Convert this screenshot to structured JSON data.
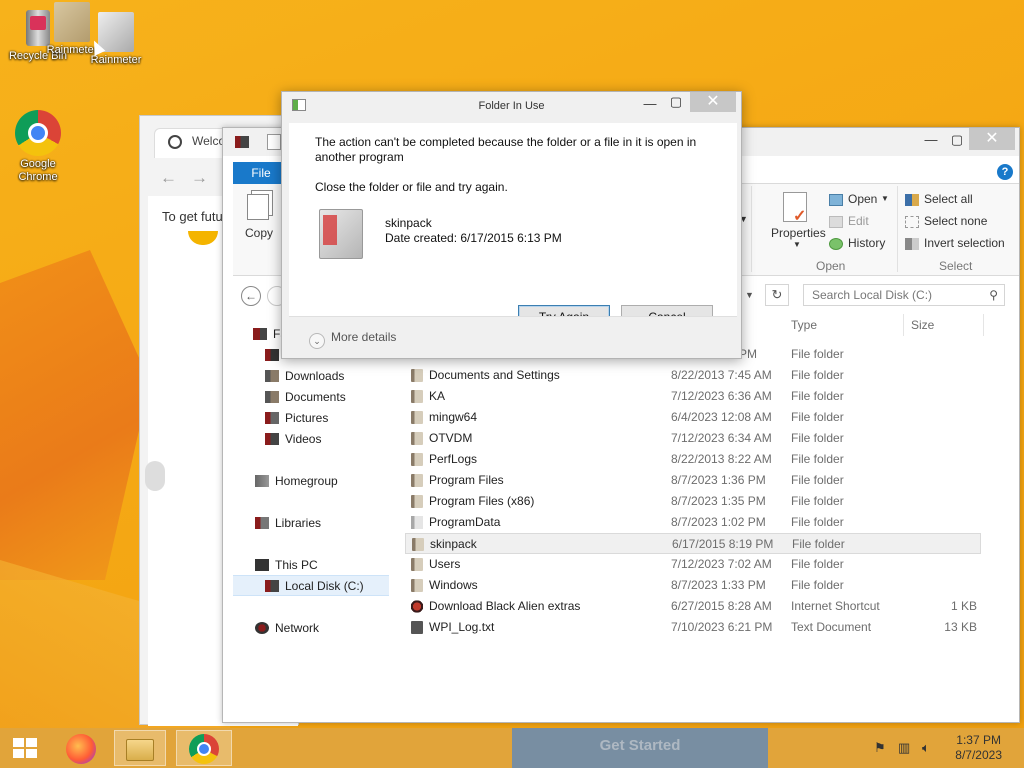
{
  "desktop": {
    "icons": [
      {
        "label": "Recycle Bin"
      },
      {
        "label": "Rainmeter"
      },
      {
        "label": "Rainmeter"
      },
      {
        "label": "Google Chrome"
      }
    ]
  },
  "browser": {
    "tab_label": "Welco",
    "page_text": "To get futu"
  },
  "explorer": {
    "ribbon": {
      "file_tab": "File",
      "copy": "Copy",
      "properties": "Properties",
      "open": "Open",
      "edit": "Edit",
      "history": "History",
      "select_all": "Select all",
      "select_none": "Select none",
      "invert_selection": "Invert selection",
      "group_open": "Open",
      "group_select": "Select"
    },
    "search_placeholder": "Search Local Disk (C:)",
    "columns": {
      "type": "Type",
      "size": "Size"
    },
    "nav": {
      "favorites": "Fa",
      "downloads": "Downloads",
      "documents": "Documents",
      "pictures": "Pictures",
      "videos": "Videos",
      "homegroup": "Homegroup",
      "libraries": "Libraries",
      "this_pc": "This PC",
      "local_disk": "Local Disk (C:)",
      "network": "Network"
    },
    "partial_row": {
      "date": "PM",
      "type": "File folder"
    },
    "rows": [
      {
        "name": "Documents and Settings",
        "date": "8/22/2013 7:45 AM",
        "type": "File folder",
        "size": ""
      },
      {
        "name": "KA",
        "date": "7/12/2023 6:36 AM",
        "type": "File folder",
        "size": ""
      },
      {
        "name": "mingw64",
        "date": "6/4/2023 12:08 AM",
        "type": "File folder",
        "size": ""
      },
      {
        "name": "OTVDM",
        "date": "7/12/2023 6:34 AM",
        "type": "File folder",
        "size": ""
      },
      {
        "name": "PerfLogs",
        "date": "8/22/2013 8:22 AM",
        "type": "File folder",
        "size": ""
      },
      {
        "name": "Program Files",
        "date": "8/7/2023 1:36 PM",
        "type": "File folder",
        "size": ""
      },
      {
        "name": "Program Files (x86)",
        "date": "8/7/2023 1:35 PM",
        "type": "File folder",
        "size": ""
      },
      {
        "name": "ProgramData",
        "date": "8/7/2023 1:02 PM",
        "type": "File folder",
        "size": ""
      },
      {
        "name": "skinpack",
        "date": "6/17/2015 8:19 PM",
        "type": "File folder",
        "size": ""
      },
      {
        "name": "Users",
        "date": "7/12/2023 7:02 AM",
        "type": "File folder",
        "size": ""
      },
      {
        "name": "Windows",
        "date": "8/7/2023 1:33 PM",
        "type": "File folder",
        "size": ""
      },
      {
        "name": "Download Black Alien extras",
        "date": "6/27/2015 8:28 AM",
        "type": "Internet Shortcut",
        "size": "1 KB"
      },
      {
        "name": "WPI_Log.txt",
        "date": "7/10/2023 6:21 PM",
        "type": "Text Document",
        "size": "13 KB"
      }
    ]
  },
  "dialog": {
    "title": "Folder In Use",
    "message": "The action can't be completed because the folder or a file in it is open in another program",
    "instruction": "Close the folder or file and try again.",
    "item_name": "skinpack",
    "item_date": "Date created: 6/17/2015 6:13 PM",
    "try_again": "Try Again",
    "cancel": "Cancel",
    "more_details": "More details"
  },
  "taskbar": {
    "get_started": "Get Started",
    "time": "1:37 PM",
    "date": "8/7/2023"
  }
}
